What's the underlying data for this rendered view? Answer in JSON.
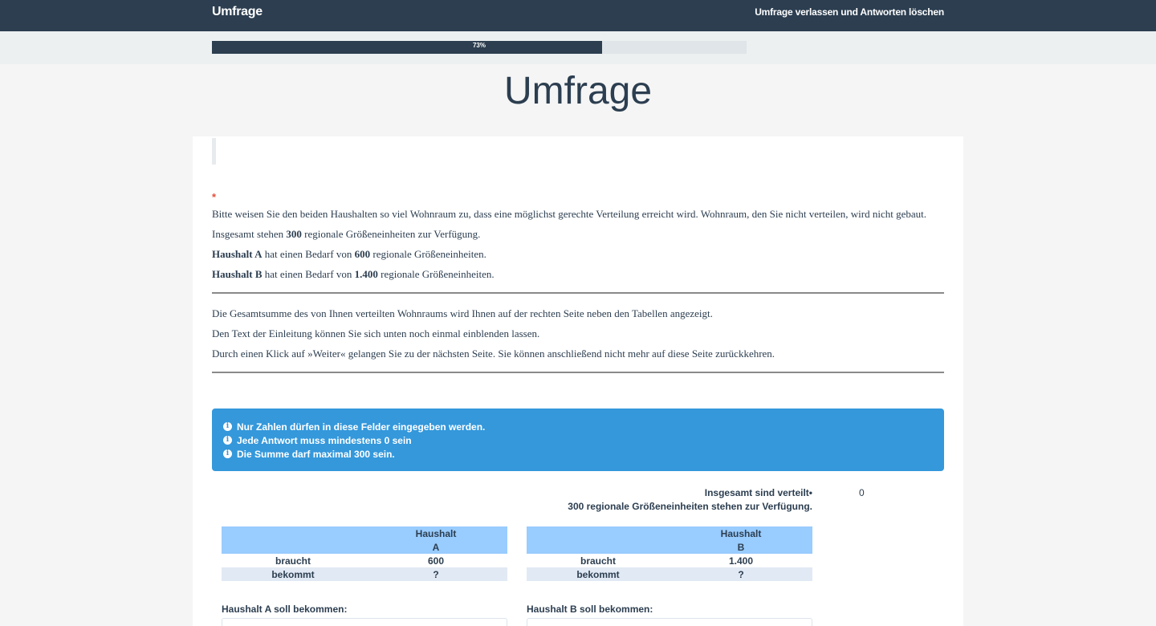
{
  "navbar": {
    "brand": "Umfrage",
    "exit_link": "Umfrage verlassen und Antworten löschen"
  },
  "progress": {
    "value_percent": 73,
    "label": "73%"
  },
  "page_title": "Umfrage",
  "question": {
    "required_marker": "*",
    "intro_lines": [
      "Bitte weisen Sie den beiden Haushalten so viel Wohnraum zu, dass eine möglichst gerechte Verteilung erreicht wird. Wohnraum, den Sie nicht verteilen, wird nicht gebaut.",
      {
        "pre": "Insgesamt stehen ",
        "bold": "300",
        "post": " regionale Größeneinheiten zur Verfügung."
      },
      {
        "bold1": "Haushalt A",
        "mid": " hat einen Bedarf von ",
        "bold2": "600",
        "post": " regionale Größeneinheiten."
      },
      {
        "bold1": "Haushalt B",
        "mid": " hat einen Bedarf von ",
        "bold2": "1.400",
        "post": " regionale Größeneinheiten."
      }
    ],
    "notes": [
      "Die Gesamtsumme des von Ihnen verteilten Wohnraums wird Ihnen auf der rechten Seite neben den Tabellen angezeigt.",
      "Den Text der Einleitung können Sie sich unten noch einmal einblenden lassen.",
      "Durch einen Klick auf »Weiter« gelangen Sie zu der nächsten Seite. Sie können anschließend nicht mehr auf diese Seite zurückkehren."
    ]
  },
  "alert": {
    "icon": "info-circle-icon",
    "color": "#3498db",
    "items": [
      "Nur Zahlen dürfen in diese Felder eingegeben werden.",
      "Jede Antwort muss mindestens 0 sein",
      "Die Summe darf maximal 300 sein."
    ]
  },
  "sum": {
    "label": "Insgesamt sind verteilt•",
    "value": "0",
    "available": "300 regionale Größeneinheiten stehen zur Verfügung."
  },
  "tables": [
    {
      "head_line1": "Haushalt",
      "head_line2": "A",
      "row1_label": "braucht",
      "row1_value": "600",
      "row2_label": "bekommt",
      "row2_value": "?"
    },
    {
      "head_line1": "Haushalt",
      "head_line2": "B",
      "row1_label": "braucht",
      "row1_value": "1.400",
      "row2_label": "bekommt",
      "row2_value": "?"
    }
  ],
  "fields": [
    {
      "label": "Haushalt A soll bekommen:",
      "value": ""
    },
    {
      "label": "Haushalt B soll bekommen:",
      "value": ""
    }
  ]
}
